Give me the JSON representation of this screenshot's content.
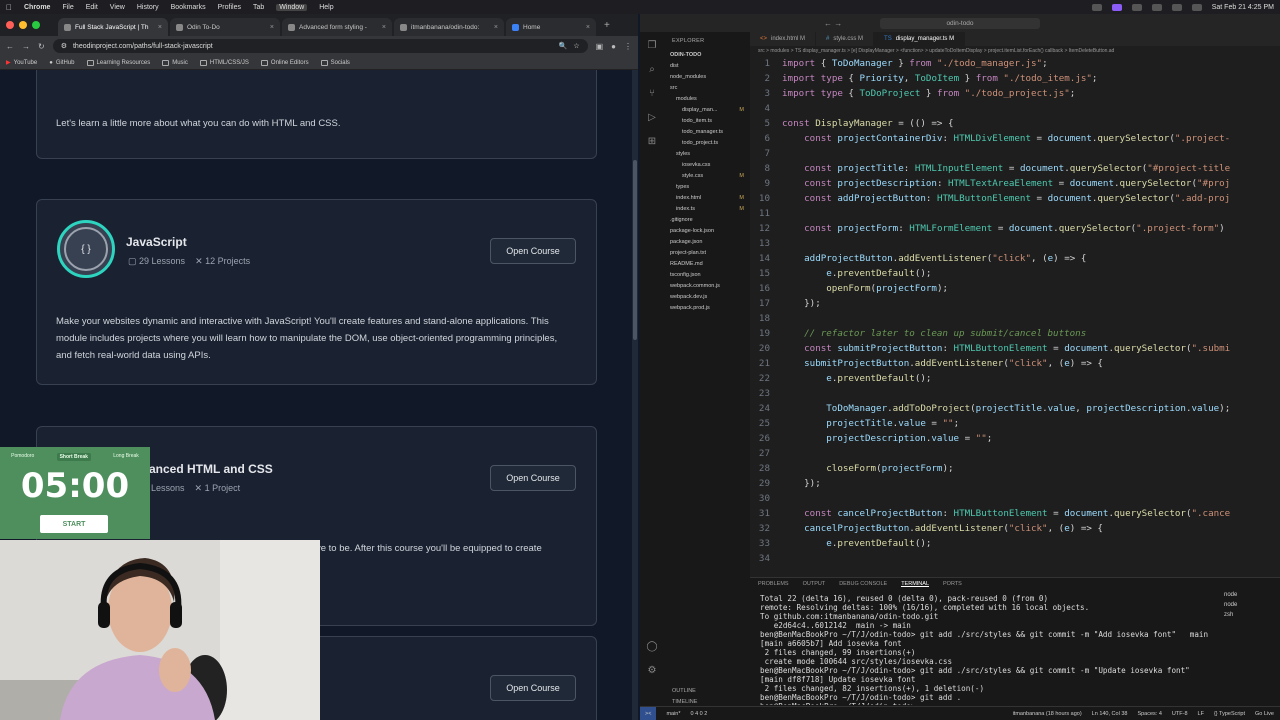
{
  "menubar": {
    "app": "Chrome",
    "items": [
      "File",
      "Edit",
      "View",
      "History",
      "Bookmarks",
      "Profiles",
      "Tab",
      "Window",
      "Help"
    ],
    "datetime": "Sat Feb 21  4:25 PM"
  },
  "chrome": {
    "tabs": [
      {
        "label": "Full Stack JavaScript | Th",
        "active": true
      },
      {
        "label": "Odin To-Do",
        "active": false
      },
      {
        "label": "Advanced form styling -",
        "active": false
      },
      {
        "label": "itmanbanana/odin-todo:",
        "active": false
      },
      {
        "label": "Home",
        "active": false
      }
    ],
    "url": "theodinproject.com/paths/full-stack-javascript",
    "bookmarks": [
      "YouTube",
      "GitHub",
      "Learning Resources",
      "Music",
      "HTML/CSS/JS",
      "Online Editors",
      "Socials"
    ]
  },
  "page": {
    "intro_text": "Let's learn a little more about what you can do with HTML and CSS.",
    "courses": [
      {
        "title": "JavaScript",
        "lessons": "29 Lessons",
        "projects": "12 Projects",
        "button": "Open Course",
        "desc": "Make your websites dynamic and interactive with JavaScript! You'll create features and stand-alone applications. This module includes projects where you will learn how to manipulate the DOM, use object-oriented programming principles, and fetch real-world data using APIs."
      },
      {
        "title": "anced HTML and CSS",
        "lessons": "Lessons",
        "projects": "1 Project",
        "button": "Open Course",
        "desc": "ve to be. After this course you'll be equipped to create"
      },
      {
        "button": "Open Course"
      }
    ]
  },
  "pomodoro": {
    "modes": [
      "Pomodoro",
      "Short Break",
      "Long Break"
    ],
    "active_mode": "Short Break",
    "time": "05:00",
    "start": "START"
  },
  "vscode": {
    "title": "odin-todo",
    "explorer_header": "EXPLORER",
    "project": "ODIN-TODO",
    "tree": [
      {
        "name": "dist",
        "indent": 1,
        "mark": ""
      },
      {
        "name": "node_modules",
        "indent": 1,
        "mark": ""
      },
      {
        "name": "src",
        "indent": 1,
        "mark": ""
      },
      {
        "name": "modules",
        "indent": 2,
        "mark": ""
      },
      {
        "name": "display_man...",
        "indent": 3,
        "mark": "M"
      },
      {
        "name": "todo_item.ts",
        "indent": 3,
        "mark": ""
      },
      {
        "name": "todo_manager.ts",
        "indent": 3,
        "mark": ""
      },
      {
        "name": "todo_project.ts",
        "indent": 3,
        "mark": ""
      },
      {
        "name": "styles",
        "indent": 2,
        "mark": ""
      },
      {
        "name": "iosevka.css",
        "indent": 3,
        "mark": ""
      },
      {
        "name": "style.css",
        "indent": 3,
        "mark": "M"
      },
      {
        "name": "types",
        "indent": 2,
        "mark": ""
      },
      {
        "name": "index.html",
        "indent": 2,
        "mark": "M"
      },
      {
        "name": "index.ts",
        "indent": 2,
        "mark": "M"
      },
      {
        "name": ".gitignore",
        "indent": 1,
        "mark": ""
      },
      {
        "name": "package-lock.json",
        "indent": 1,
        "mark": ""
      },
      {
        "name": "package.json",
        "indent": 1,
        "mark": ""
      },
      {
        "name": "project-plan.txt",
        "indent": 1,
        "mark": ""
      },
      {
        "name": "README.md",
        "indent": 1,
        "mark": ""
      },
      {
        "name": "tsconfig.json",
        "indent": 1,
        "mark": ""
      },
      {
        "name": "webpack.common.js",
        "indent": 1,
        "mark": ""
      },
      {
        "name": "webpack.dev.js",
        "indent": 1,
        "mark": ""
      },
      {
        "name": "webpack.prod.js",
        "indent": 1,
        "mark": ""
      }
    ],
    "outline": [
      "OUTLINE",
      "TIMELINE"
    ],
    "editor_tabs": [
      {
        "label": "index.html M",
        "active": false
      },
      {
        "label": "style.css M",
        "active": false
      },
      {
        "label": "display_manager.ts M",
        "active": true
      }
    ],
    "breadcrumbs": "src > modules > TS display_manager.ts > [e] DisplayManager > <function> > updateToDoItemDisplay > project.itemList.forEach() callback > ItemDeleteButton.ad",
    "panel_tabs": [
      "PROBLEMS",
      "OUTPUT",
      "DEBUG CONSOLE",
      "TERMINAL",
      "PORTS"
    ],
    "active_panel": "TERMINAL",
    "terminal": [
      "Total 22 (delta 16), reused 0 (delta 0), pack-reused 0 (from 0)",
      "remote: Resolving deltas: 100% (16/16), completed with 16 local objects.",
      "To github.com:itmanbanana/odin-todo.git",
      "   e2d64c4..6012142  main -> main",
      "ben@BenMacBookPro ~/T/J/odin-todo> git add ./src/styles && git commit -m \"Add iosevka font\"   main",
      "[main a6605b7] Add iosevka font",
      " 2 files changed, 99 insertions(+)",
      " create mode 100644 src/styles/iosevka.css",
      "ben@BenMacBookPro ~/T/J/odin-todo> git add ./src/styles && git commit -m \"Update iosevka font\"",
      "[main df8f718] Update iosevka font",
      " 2 files changed, 82 insertions(+), 1 deletion(-)",
      "ben@BenMacBookPro ~/T/J/odin-todo> git add .",
      "ben@BenMacBookPro ~/T/J/odin-todo> "
    ],
    "terminal_side": [
      "node",
      "node",
      "zsh"
    ],
    "status": {
      "branch": "main*",
      "problems": "0 4  0 2",
      "right": [
        "itmanbanana (18 hours ago)",
        "Ln 140, Col 38",
        "Spaces: 4",
        "UTF-8",
        "LF",
        "{} TypeScript",
        "Go Live"
      ]
    }
  }
}
